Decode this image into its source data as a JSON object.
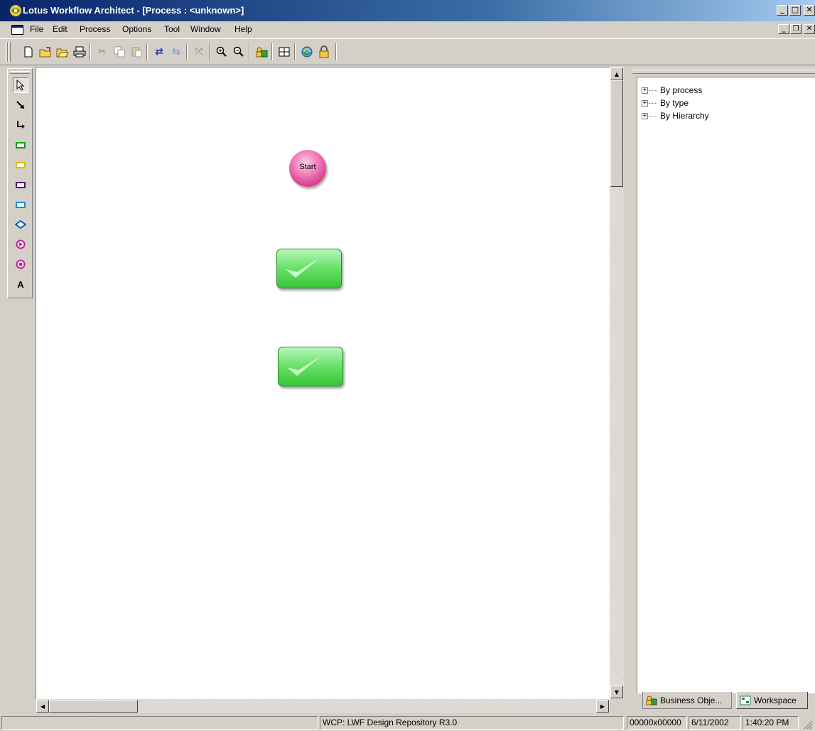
{
  "window": {
    "title": "Lotus Workflow Architect - [Process : <unknown>]",
    "min_glyph": "_",
    "max_glyph": "□",
    "close_glyph": "✕",
    "restore_glyph": "❐"
  },
  "menu": {
    "items": [
      "File",
      "Edit",
      "Process",
      "Options",
      "Tool",
      "Window",
      "Help"
    ]
  },
  "toolbar": {
    "buttons": [
      "new-icon",
      "open-icon",
      "open-folder-icon",
      "print-icon",
      "cut-icon",
      "copy-icon",
      "paste-icon",
      "redo-arrow-icon",
      "undo-arrow-icon",
      "fit-icon",
      "zoom-in-icon",
      "zoom-out-icon",
      "business-objects-icon",
      "grid-icon",
      "refresh-icon",
      "lock-icon"
    ]
  },
  "palette": {
    "tools": [
      "pointer-icon",
      "connector-icon",
      "elbow-connector-icon",
      "green-activity-icon",
      "yellow-activity-icon",
      "purple-activity-icon",
      "blue-activity-icon",
      "decision-icon",
      "start-node-icon",
      "end-node-icon",
      "text-tool-icon"
    ],
    "text_tool_label": "A"
  },
  "canvas": {
    "start_label": "Start",
    "tasks": [
      "task-1",
      "task-2"
    ]
  },
  "tree": {
    "items": [
      "By process",
      "By type",
      "By Hierarchy"
    ],
    "expander": "+"
  },
  "tabs": {
    "business_objects": "Business Obje...",
    "workspace": "Workspace"
  },
  "statusbar": {
    "repository": "WCP: LWF Design Repository R3.0",
    "coords": "00000x00000",
    "date": "6/11/2002",
    "time": "1:40:20 PM"
  },
  "colors": {
    "title_bar": "#0a246a",
    "start_node": "#e0559c",
    "task_node": "#5dd85d"
  }
}
